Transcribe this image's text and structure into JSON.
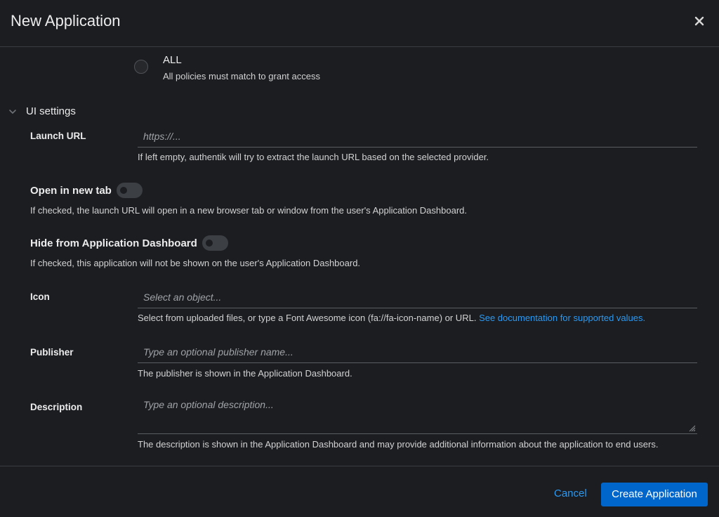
{
  "dialog": {
    "title": "New Application",
    "close_icon": "close-icon"
  },
  "policy_mode": {
    "option_label": "ALL",
    "option_description": "All policies must match to grant access",
    "selected": false
  },
  "ui_settings": {
    "section_title": "UI settings",
    "toggle_icon": "chevron-down-icon",
    "launch_url": {
      "label": "Launch URL",
      "placeholder": "https://...",
      "value": "",
      "helper": "If left empty, authentik will try to extract the launch URL based on the selected provider."
    },
    "open_in_new_tab": {
      "label": "Open in new tab",
      "checked": false,
      "helper": "If checked, the launch URL will open in a new browser tab or window from the user's Application Dashboard."
    },
    "hide_from_dashboard": {
      "label": "Hide from Application Dashboard",
      "checked": false,
      "helper": "If checked, this application will not be shown on the user's Application Dashboard."
    },
    "icon": {
      "label": "Icon",
      "placeholder": "Select an object...",
      "helper": "Select from uploaded files, or type a Font Awesome icon (fa://fa-icon-name) or URL.",
      "helper_link": "See documentation for supported values."
    },
    "publisher": {
      "label": "Publisher",
      "placeholder": "Type an optional publisher name...",
      "value": "",
      "helper": "The publisher is shown in the Application Dashboard."
    },
    "description": {
      "label": "Description",
      "placeholder": "Type an optional description...",
      "value": "",
      "helper": "The description is shown in the Application Dashboard and may provide additional information about the application to end users."
    }
  },
  "footer": {
    "cancel_label": "Cancel",
    "create_label": "Create Application"
  },
  "colors": {
    "background": "#1b1d21",
    "accent_link": "#2b9af3",
    "primary_button": "#0066cc",
    "divider": "#3a3d42"
  }
}
